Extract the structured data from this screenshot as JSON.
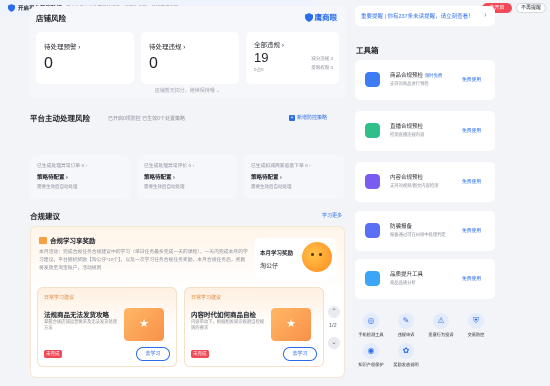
{
  "risk": {
    "title": "店铺风险",
    "brand": "鹰商眼",
    "pending_violations": {
      "label": "待处理预警",
      "value": "0"
    },
    "handling_violations": {
      "label": "待处理违规",
      "value": "0"
    },
    "all_violations": {
      "label": "全部违规",
      "value": "19",
      "sub": "0占0",
      "right1": "减分违规 3",
      "right2": "受限权限 0"
    },
    "note": "店铺暂无扣分，继续保持哦 ⌄"
  },
  "platform": {
    "title": "平台主动处理风险",
    "subtitle": "已开启0项防控 已生效0个处置策略",
    "new_strategy": "新增防控策略",
    "alert_title": "开启平台智能防控",
    "alert_desc": "平台为您主动处置风险订单、商家失信等，快速获得保障",
    "btn_enable": "去开启",
    "btn_later": "不再提醒",
    "boxes": [
      {
        "l1": "已生成处理异常订单 0 ›",
        "l2": "策略待配置 ›",
        "l3": "需要生效后自动处理"
      },
      {
        "l1": "已生成处理异常评价 0 ›",
        "l2": "策略待配置 ›",
        "l3": "需要生效后自动处理"
      },
      {
        "l1": "已生成扣减商家恶意下单 0 ›",
        "l2": "策略待配置 ›",
        "l3": "需要生效后自动处理"
      }
    ]
  },
  "compliance": {
    "section_title": "合规建议",
    "learn_more": "学习更多",
    "card_title": "合规学习享奖励",
    "card_text": "本月活动：完成合规任务合规建议中的学习（单日任务最多完成一天的课程），一天内完成本月的学习建议，平台随机奖励【淘公仔*10个】，以及一次学习任务合规任务奖励，本月合规任务后，奖励将发放至淘宝账户，活动规则",
    "reward_title": "本月学习奖励",
    "reward_item": "淘公仔",
    "pagination": "1/2",
    "lessons": [
      {
        "tag": "日常学习建议",
        "title": "法规商品无法发货攻略",
        "desc": "掌握合规店铺运营要求及无法发货处理方法",
        "badge": "未完成",
        "button": "去学习"
      },
      {
        "tag": "日常学习建议",
        "title": "内容时代如何商品自检",
        "desc": "内容带动下，根据相关知识规避自检规则的要求",
        "badge": "未完成",
        "button": "去学习"
      }
    ]
  },
  "right": {
    "notice": "重要提醒 | 你有237条未读提醒，请立刻查看！",
    "tools_title": "工具箱",
    "tools": [
      {
        "name": "商品合规预检",
        "tag": "限时免费",
        "desc": "支持对商品进行预检",
        "free": "免费使用",
        "color": "#3d7cf2"
      },
      {
        "name": "直播合规预检",
        "tag": "",
        "desc": "检测直播违规内容",
        "free": "免费使用",
        "color": "#2fbf8a"
      },
      {
        "name": "内容合规预检",
        "tag": "",
        "desc": "支持对视频/图文内容检测",
        "free": "免费使用",
        "color": "#7b5cf0"
      },
      {
        "name": "防骗报备",
        "tag": "",
        "desc": "报备通过可在纠纷中处理判定",
        "free": "免费使用",
        "color": "#5b6ff5"
      },
      {
        "name": "品质提升工具",
        "tag": "",
        "desc": "商品品质分析",
        "free": "免费使用",
        "color": "#3aa6f5"
      }
    ],
    "shortcuts": [
      {
        "label": "手机检测工具",
        "icon": "◎"
      },
      {
        "label": "违规申诉",
        "icon": "✎"
      },
      {
        "label": "恶意行为投诉",
        "icon": "⚠"
      },
      {
        "label": "交易防控",
        "icon": "⛨"
      },
      {
        "label": "知识产权保护",
        "icon": "◉"
      },
      {
        "label": "奖励发放说明",
        "icon": "✿"
      }
    ]
  }
}
